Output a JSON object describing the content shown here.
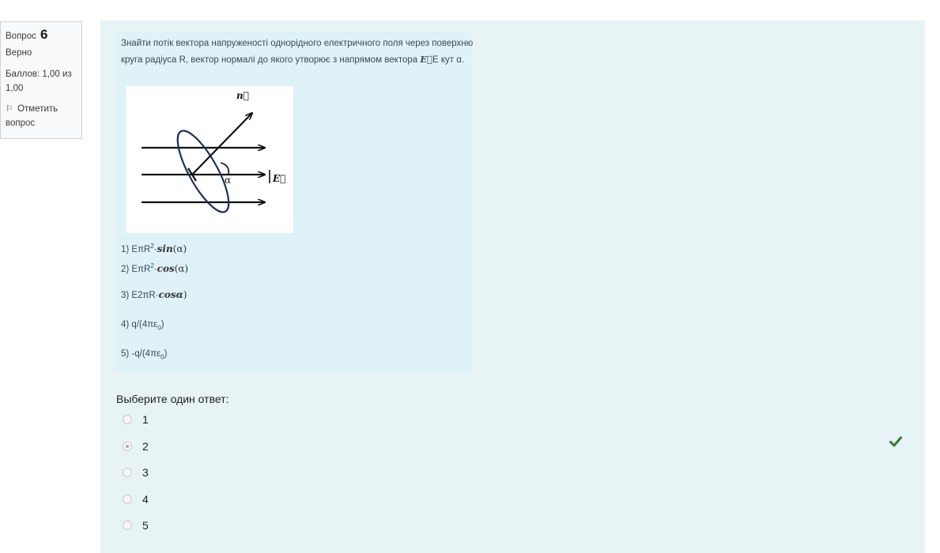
{
  "info": {
    "question_label": "Вопрос",
    "question_number": "6",
    "state": "Верно",
    "grade": "Баллов: 1,00 из 1,00",
    "flag_label": "Отметить вопрос"
  },
  "question": {
    "stem_before": "Знайти потік вектора напруженості однорідного електричного поля через поверхню круга радіуса R, вектор нормалі до якого утворює з напрямом вектора ",
    "stem_vec": "E⃗",
    "stem_after": "E кут α.",
    "figure": {
      "normal_label": "n⃗",
      "angle_label": "α",
      "field_label": "E⃗"
    },
    "options": [
      {
        "prefix": "1) EπR",
        "sup": "2",
        "mid": "·",
        "math": "sin",
        "tail": "(α)"
      },
      {
        "prefix": "2) EπR",
        "sup": "2",
        "mid": "·",
        "math": "cos",
        "tail": "(α)"
      },
      {
        "prefix": "3) E2πR·",
        "sup": "",
        "mid": "",
        "math": "cosα",
        "tail": ")"
      },
      {
        "prefix": "4) q/(4πε",
        "sub": "0",
        "tail": ")"
      },
      {
        "prefix": "5) -q/(4πε",
        "sub": "0",
        "tail": ")"
      }
    ]
  },
  "prompt": "Выберите один ответ:",
  "answers": [
    {
      "label": "1",
      "checked": false
    },
    {
      "label": "2",
      "checked": true
    },
    {
      "label": "3",
      "checked": false
    },
    {
      "label": "4",
      "checked": false
    },
    {
      "label": "5",
      "checked": false
    }
  ],
  "status": {
    "icon": "checkmark-icon",
    "color": "#357a32"
  }
}
